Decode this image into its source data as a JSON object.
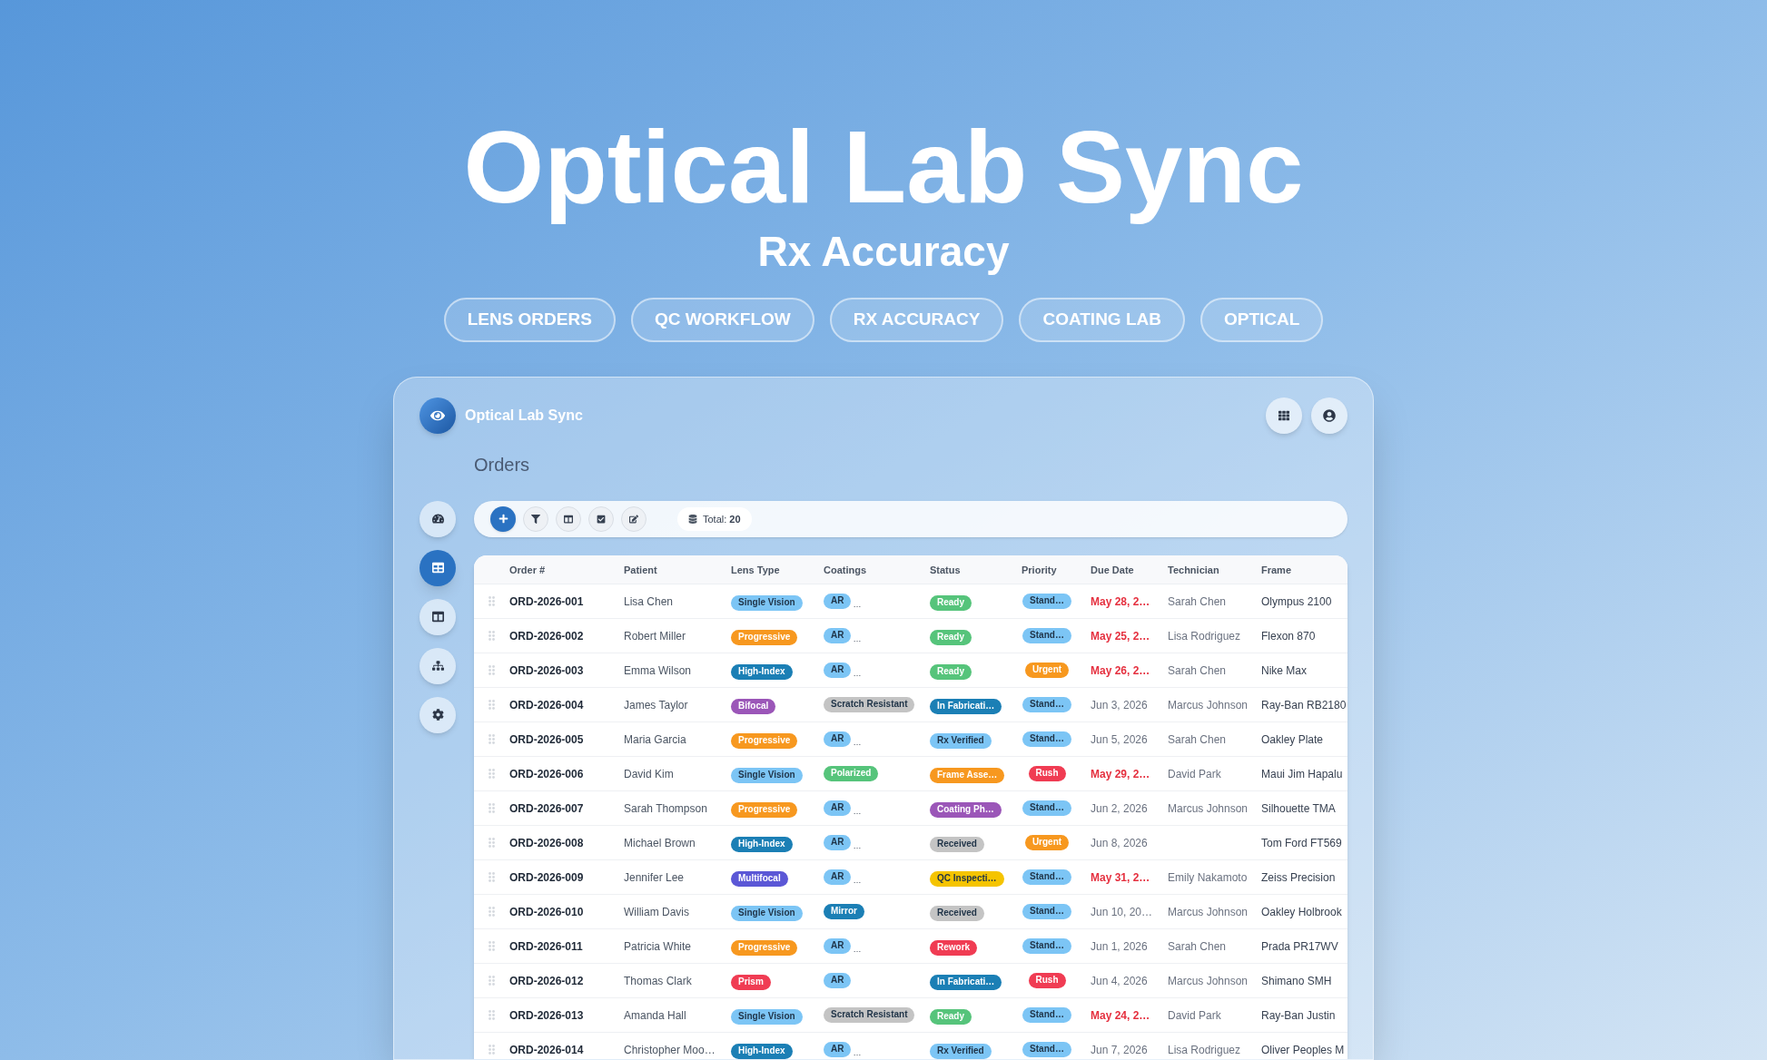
{
  "hero": {
    "title": "Optical Lab Sync",
    "subtitle": "Rx Accuracy",
    "tags": [
      "LENS ORDERS",
      "QC WORKFLOW",
      "RX ACCURACY",
      "COATING LAB",
      "OPTICAL"
    ]
  },
  "app": {
    "title": "Optical Lab Sync"
  },
  "page_title": "Orders",
  "sidebar": {
    "items": [
      {
        "selected": false
      },
      {
        "selected": true
      },
      {
        "selected": false
      },
      {
        "selected": false
      },
      {
        "selected": false
      }
    ]
  },
  "toolbar": {
    "total": "Total: **20**"
  },
  "table": {
    "columns": [
      "Order #",
      "Patient",
      "Lens Type",
      "Coatings",
      "Status",
      "Priority",
      "Due Date",
      "Technician",
      "Frame"
    ],
    "rows": [
      {
        "order": "ORD-2026-001",
        "patient": "Lisa Chen",
        "lens_type": {
          "label": "Single Vision",
          "color": "#7cc5f5"
        },
        "coating": {
          "label": "AR",
          "color": "#7cc5f5",
          "overflow": "…"
        },
        "status": {
          "label": "Ready",
          "color": "#56c47b"
        },
        "priority": {
          "label": "Stand…",
          "color": "#7cc5f5"
        },
        "due": {
          "text": "May 28, 2…",
          "overdue": true
        },
        "technician": "Sarah Chen",
        "frame": "Olympus 2100"
      },
      {
        "order": "ORD-2026-002",
        "patient": "Robert Miller",
        "lens_type": {
          "label": "Progressive",
          "color": "#f7981f"
        },
        "coating": {
          "label": "AR",
          "color": "#7cc5f5",
          "overflow": "…"
        },
        "status": {
          "label": "Ready",
          "color": "#56c47b"
        },
        "priority": {
          "label": "Stand…",
          "color": "#7cc5f5"
        },
        "due": {
          "text": "May 25, 2…",
          "overdue": true
        },
        "technician": "Lisa Rodriguez",
        "frame": "Flexon 870"
      },
      {
        "order": "ORD-2026-003",
        "patient": "Emma Wilson",
        "lens_type": {
          "label": "High-Index",
          "color": "#1b7fb5"
        },
        "coating": {
          "label": "AR",
          "color": "#7cc5f5",
          "overflow": "…"
        },
        "status": {
          "label": "Ready",
          "color": "#56c47b"
        },
        "priority": {
          "label": "Urgent",
          "color": "#f7981f"
        },
        "due": {
          "text": "May 26, 2…",
          "overdue": true
        },
        "technician": "Sarah Chen",
        "frame": "Nike Max"
      },
      {
        "order": "ORD-2026-004",
        "patient": "James Taylor",
        "lens_type": {
          "label": "Bifocal",
          "color": "#9b56b8"
        },
        "coating": {
          "label": "Scratch Resistant",
          "color": "#c4c4c4"
        },
        "status": {
          "label": "In Fabricati…",
          "color": "#1b7fb5"
        },
        "priority": {
          "label": "Stand…",
          "color": "#7cc5f5"
        },
        "due": {
          "text": "Jun 3, 2026",
          "overdue": false
        },
        "technician": "Marcus Johnson",
        "frame": "Ray-Ban RB2180"
      },
      {
        "order": "ORD-2026-005",
        "patient": "Maria Garcia",
        "lens_type": {
          "label": "Progressive",
          "color": "#f7981f"
        },
        "coating": {
          "label": "AR",
          "color": "#7cc5f5",
          "overflow": "…"
        },
        "status": {
          "label": "Rx Verified",
          "color": "#7cc5f5"
        },
        "priority": {
          "label": "Stand…",
          "color": "#7cc5f5"
        },
        "due": {
          "text": "Jun 5, 2026",
          "overdue": false
        },
        "technician": "Sarah Chen",
        "frame": "Oakley Plate"
      },
      {
        "order": "ORD-2026-006",
        "patient": "David Kim",
        "lens_type": {
          "label": "Single Vision",
          "color": "#7cc5f5"
        },
        "coating": {
          "label": "Polarized",
          "color": "#56c47b"
        },
        "status": {
          "label": "Frame Asse…",
          "color": "#f7981f"
        },
        "priority": {
          "label": "Rush",
          "color": "#f03c53"
        },
        "due": {
          "text": "May 29, 2…",
          "overdue": true
        },
        "technician": "David Park",
        "frame": "Maui Jim Hapalu"
      },
      {
        "order": "ORD-2026-007",
        "patient": "Sarah Thompson",
        "lens_type": {
          "label": "Progressive",
          "color": "#f7981f"
        },
        "coating": {
          "label": "AR",
          "color": "#7cc5f5",
          "overflow": "…"
        },
        "status": {
          "label": "Coating Ph…",
          "color": "#9b56b8"
        },
        "priority": {
          "label": "Stand…",
          "color": "#7cc5f5"
        },
        "due": {
          "text": "Jun 2, 2026",
          "overdue": false
        },
        "technician": "Marcus Johnson",
        "frame": "Silhouette TMA"
      },
      {
        "order": "ORD-2026-008",
        "patient": "Michael Brown",
        "lens_type": {
          "label": "High-Index",
          "color": "#1b7fb5"
        },
        "coating": {
          "label": "AR",
          "color": "#7cc5f5",
          "overflow": "…"
        },
        "status": {
          "label": "Received",
          "color": "#c4c4c4"
        },
        "priority": {
          "label": "Urgent",
          "color": "#f7981f"
        },
        "due": {
          "text": "Jun 8, 2026",
          "overdue": false
        },
        "frame": "Tom Ford FT569"
      },
      {
        "order": "ORD-2026-009",
        "patient": "Jennifer Lee",
        "lens_type": {
          "label": "Multifocal",
          "color": "#5b57d6"
        },
        "coating": {
          "label": "AR",
          "color": "#7cc5f5",
          "overflow": "…"
        },
        "status": {
          "label": "QC Inspecti…",
          "color": "#f5c400"
        },
        "priority": {
          "label": "Stand…",
          "color": "#7cc5f5"
        },
        "due": {
          "text": "May 31, 2…",
          "overdue": true
        },
        "technician": "Emily Nakamoto",
        "frame": "Zeiss Precision"
      },
      {
        "order": "ORD-2026-010",
        "patient": "William Davis",
        "lens_type": {
          "label": "Single Vision",
          "color": "#7cc5f5"
        },
        "coating": {
          "label": "Mirror",
          "color": "#1b7fb5"
        },
        "status": {
          "label": "Received",
          "color": "#c4c4c4"
        },
        "priority": {
          "label": "Stand…",
          "color": "#7cc5f5"
        },
        "due": {
          "text": "Jun 10, 20…",
          "overdue": false
        },
        "technician": "Marcus Johnson",
        "frame": "Oakley Holbrook"
      },
      {
        "order": "ORD-2026-011",
        "patient": "Patricia White",
        "lens_type": {
          "label": "Progressive",
          "color": "#f7981f"
        },
        "coating": {
          "label": "AR",
          "color": "#7cc5f5",
          "overflow": "…"
        },
        "status": {
          "label": "Rework",
          "color": "#f03c53"
        },
        "priority": {
          "label": "Stand…",
          "color": "#7cc5f5"
        },
        "due": {
          "text": "Jun 1, 2026",
          "overdue": false
        },
        "technician": "Sarah Chen",
        "frame": "Prada PR17WV"
      },
      {
        "order": "ORD-2026-012",
        "patient": "Thomas Clark",
        "lens_type": {
          "label": "Prism",
          "color": "#f03c53"
        },
        "coating": {
          "label": "AR",
          "color": "#7cc5f5"
        },
        "status": {
          "label": "In Fabricati…",
          "color": "#1b7fb5"
        },
        "priority": {
          "label": "Rush",
          "color": "#f03c53"
        },
        "due": {
          "text": "Jun 4, 2026",
          "overdue": false
        },
        "technician": "Marcus Johnson",
        "frame": "Shimano SMH"
      },
      {
        "order": "ORD-2026-013",
        "patient": "Amanda Hall",
        "lens_type": {
          "label": "Single Vision",
          "color": "#7cc5f5"
        },
        "coating": {
          "label": "Scratch Resistant",
          "color": "#c4c4c4"
        },
        "status": {
          "label": "Ready",
          "color": "#56c47b"
        },
        "priority": {
          "label": "Stand…",
          "color": "#7cc5f5"
        },
        "due": {
          "text": "May 24, 2…",
          "overdue": true
        },
        "technician": "David Park",
        "frame": "Ray-Ban Justin"
      },
      {
        "order": "ORD-2026-014",
        "patient": "Christopher Moo…",
        "lens_type": {
          "label": "High-Index",
          "color": "#1b7fb5"
        },
        "coating": {
          "label": "AR",
          "color": "#7cc5f5",
          "overflow": "…"
        },
        "status": {
          "label": "Rx Verified",
          "color": "#7cc5f5"
        },
        "priority": {
          "label": "Stand…",
          "color": "#7cc5f5"
        },
        "due": {
          "text": "Jun 7, 2026",
          "overdue": false
        },
        "technician": "Lisa Rodriguez",
        "frame": "Oliver Peoples M"
      }
    ]
  }
}
